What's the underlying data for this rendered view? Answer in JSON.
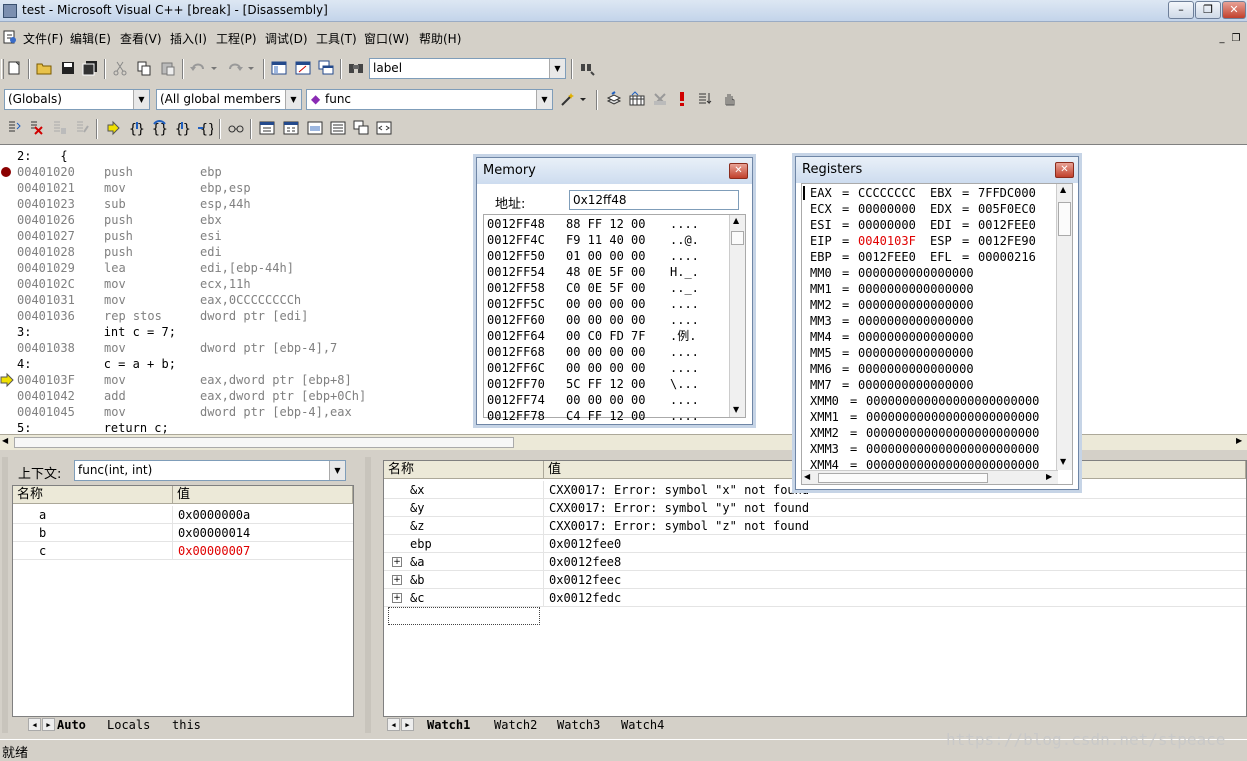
{
  "window": {
    "title": "test - Microsoft Visual C++ [break] - [Disassembly]"
  },
  "menu": [
    "文件(F)",
    "编辑(E)",
    "查看(V)",
    "插入(I)",
    "工程(P)",
    "调试(D)",
    "工具(T)",
    "窗口(W)",
    "帮助(H)"
  ],
  "toolbar": {
    "find_combo": "label",
    "globals_combo": "(Globals)",
    "members_combo": "(All global members",
    "function_combo": "func"
  },
  "disasm": [
    {
      "kind": "src",
      "text": "2:    {"
    },
    {
      "kind": "asm",
      "addr": "00401020",
      "op": "push",
      "args": "ebp",
      "marker": "breakpoint"
    },
    {
      "kind": "asm",
      "addr": "00401021",
      "op": "mov",
      "args": "ebp,esp"
    },
    {
      "kind": "asm",
      "addr": "00401023",
      "op": "sub",
      "args": "esp,44h"
    },
    {
      "kind": "asm",
      "addr": "00401026",
      "op": "push",
      "args": "ebx"
    },
    {
      "kind": "asm",
      "addr": "00401027",
      "op": "push",
      "args": "esi"
    },
    {
      "kind": "asm",
      "addr": "00401028",
      "op": "push",
      "args": "edi"
    },
    {
      "kind": "asm",
      "addr": "00401029",
      "op": "lea",
      "args": "edi,[ebp-44h]"
    },
    {
      "kind": "asm",
      "addr": "0040102C",
      "op": "mov",
      "args": "ecx,11h"
    },
    {
      "kind": "asm",
      "addr": "00401031",
      "op": "mov",
      "args": "eax,0CCCCCCCCh"
    },
    {
      "kind": "asm",
      "addr": "00401036",
      "op": "rep stos",
      "args": "dword ptr [edi]"
    },
    {
      "kind": "src",
      "text": "3:          int c = 7;"
    },
    {
      "kind": "asm",
      "addr": "00401038",
      "op": "mov",
      "args": "dword ptr [ebp-4],7"
    },
    {
      "kind": "src",
      "text": "4:          c = a + b;"
    },
    {
      "kind": "asm",
      "addr": "0040103F",
      "op": "mov",
      "args": "eax,dword ptr [ebp+8]",
      "marker": "current"
    },
    {
      "kind": "asm",
      "addr": "00401042",
      "op": "add",
      "args": "eax,dword ptr [ebp+0Ch]"
    },
    {
      "kind": "asm",
      "addr": "00401045",
      "op": "mov",
      "args": "dword ptr [ebp-4],eax"
    },
    {
      "kind": "src",
      "text": "5:          return c;"
    }
  ],
  "memory": {
    "title": "Memory",
    "address_label": "地址:",
    "address_value": "0x12ff48",
    "rows": [
      {
        "addr": "0012FF48",
        "bytes": "88 FF 12 00",
        "ascii": "...."
      },
      {
        "addr": "0012FF4C",
        "bytes": "F9 11 40 00",
        "ascii": "..@."
      },
      {
        "addr": "0012FF50",
        "bytes": "01 00 00 00",
        "ascii": "...."
      },
      {
        "addr": "0012FF54",
        "bytes": "48 0E 5F 00",
        "ascii": "H._."
      },
      {
        "addr": "0012FF58",
        "bytes": "C0 0E 5F 00",
        "ascii": ".._."
      },
      {
        "addr": "0012FF5C",
        "bytes": "00 00 00 00",
        "ascii": "...."
      },
      {
        "addr": "0012FF60",
        "bytes": "00 00 00 00",
        "ascii": "...."
      },
      {
        "addr": "0012FF64",
        "bytes": "00 C0 FD 7F",
        "ascii": ".例."
      },
      {
        "addr": "0012FF68",
        "bytes": "00 00 00 00",
        "ascii": "...."
      },
      {
        "addr": "0012FF6C",
        "bytes": "00 00 00 00",
        "ascii": "...."
      },
      {
        "addr": "0012FF70",
        "bytes": "5C FF 12 00",
        "ascii": "\\..."
      },
      {
        "addr": "0012FF74",
        "bytes": "00 00 00 00",
        "ascii": "...."
      },
      {
        "addr": "0012FF78",
        "bytes": "C4 FF 12 00",
        "ascii": "...."
      }
    ]
  },
  "registers": {
    "title": "Registers",
    "rows": [
      {
        "a": "EAX",
        "av": "CCCCCCCC",
        "b": "EBX",
        "bv": "7FFDC000"
      },
      {
        "a": "ECX",
        "av": "00000000",
        "b": "EDX",
        "bv": "005F0EC0"
      },
      {
        "a": "ESI",
        "av": "00000000",
        "b": "EDI",
        "bv": "0012FEE0"
      },
      {
        "a": "EIP",
        "av": "0040103F",
        "b": "ESP",
        "bv": "0012FE90",
        "changed": true
      },
      {
        "a": "EBP",
        "av": "0012FEE0",
        "b": "EFL",
        "bv": "00000216"
      },
      {
        "a": "MM0",
        "av": "0000000000000000"
      },
      {
        "a": "MM1",
        "av": "0000000000000000"
      },
      {
        "a": "MM2",
        "av": "0000000000000000"
      },
      {
        "a": "MM3",
        "av": "0000000000000000"
      },
      {
        "a": "MM4",
        "av": "0000000000000000"
      },
      {
        "a": "MM5",
        "av": "0000000000000000"
      },
      {
        "a": "MM6",
        "av": "0000000000000000"
      },
      {
        "a": "MM7",
        "av": "0000000000000000"
      },
      {
        "a": "XMM0",
        "av": "000000000000000000000000"
      },
      {
        "a": "XMM1",
        "av": "000000000000000000000000"
      },
      {
        "a": "XMM2",
        "av": "000000000000000000000000"
      },
      {
        "a": "XMM3",
        "av": "000000000000000000000000"
      },
      {
        "a": "XMM4",
        "av": "000000000000000000000000"
      }
    ]
  },
  "variables": {
    "context_label": "上下文:",
    "context_value": "func(int, int)",
    "col_name": "名称",
    "col_value": "值",
    "rows": [
      {
        "name": "a",
        "value": "0x0000000a"
      },
      {
        "name": "b",
        "value": "0x00000014"
      },
      {
        "name": "c",
        "value": "0x00000007",
        "changed": true
      }
    ],
    "tabs": [
      "Auto",
      "Locals",
      "this"
    ]
  },
  "watch": {
    "col_name": "名称",
    "col_value": "值",
    "rows": [
      {
        "name": "&x",
        "value": "CXX0017: Error: symbol \"x\" not found"
      },
      {
        "name": "&y",
        "value": "CXX0017: Error: symbol \"y\" not found"
      },
      {
        "name": "&z",
        "value": "CXX0017: Error: symbol \"z\" not found"
      },
      {
        "name": "ebp",
        "value": "0x0012fee0"
      },
      {
        "name": "&a",
        "value": "0x0012fee8",
        "expand": true
      },
      {
        "name": "&b",
        "value": "0x0012feec",
        "expand": true
      },
      {
        "name": "&c",
        "value": "0x0012fedc",
        "expand": true
      }
    ],
    "tabs": [
      "Watch1",
      "Watch2",
      "Watch3",
      "Watch4"
    ]
  },
  "status": {
    "text": "就绪",
    "watermark": "https://blog.csdn.net/stpeace"
  },
  "colors": {
    "changed_value": "#e00000",
    "breakpoint": "#8b0000",
    "current_arrow": "#f0e000"
  }
}
